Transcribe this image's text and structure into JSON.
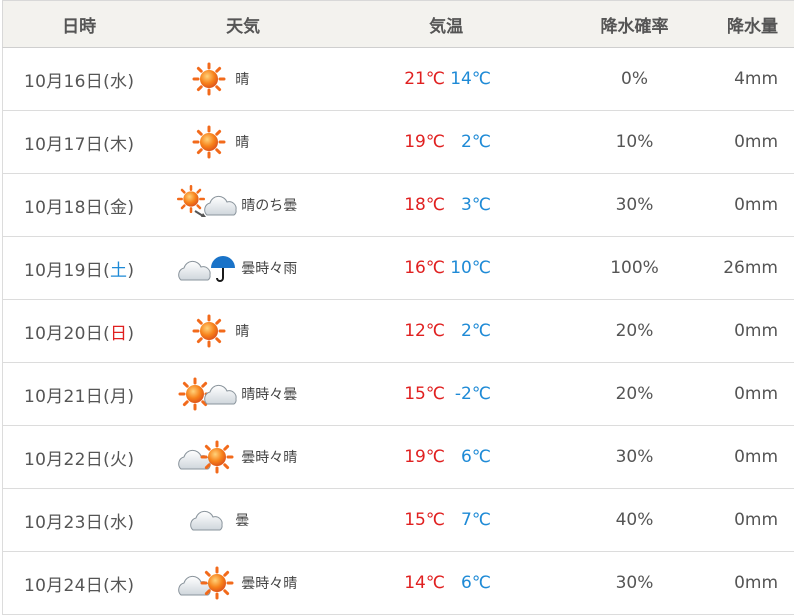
{
  "header": {
    "date": "日時",
    "weather": "天気",
    "temp": "気温",
    "prob": "降水確率",
    "amount": "降水量"
  },
  "colors": {
    "high": "#e02020",
    "low": "#1e8ad6",
    "saturday": "#1e8ad6",
    "sunday": "#e02020"
  },
  "rows": [
    {
      "date_pre": "10月16日(",
      "dow": "水",
      "date_post": ")",
      "dow_type": "",
      "icon": "sun-icon",
      "weather": "晴",
      "high": "21℃",
      "low": "14℃",
      "prob": "0%",
      "amount": "4mm"
    },
    {
      "date_pre": "10月17日(",
      "dow": "木",
      "date_post": ")",
      "dow_type": "",
      "icon": "sun-icon",
      "weather": "晴",
      "high": "19℃",
      "low": "2℃",
      "prob": "10%",
      "amount": "0mm"
    },
    {
      "date_pre": "10月18日(",
      "dow": "金",
      "date_post": ")",
      "dow_type": "",
      "icon": "sun-then-cloud-icon",
      "weather": "晴のち曇",
      "high": "18℃",
      "low": "3℃",
      "prob": "30%",
      "amount": "0mm"
    },
    {
      "date_pre": "10月19日(",
      "dow": "土",
      "date_post": ")",
      "dow_type": "sat",
      "icon": "cloud-sometimes-rain-icon",
      "weather": "曇時々雨",
      "high": "16℃",
      "low": "10℃",
      "prob": "100%",
      "amount": "26mm"
    },
    {
      "date_pre": "10月20日(",
      "dow": "日",
      "date_post": ")",
      "dow_type": "sun",
      "icon": "sun-icon",
      "weather": "晴",
      "high": "12℃",
      "low": "2℃",
      "prob": "20%",
      "amount": "0mm"
    },
    {
      "date_pre": "10月21日(",
      "dow": "月",
      "date_post": ")",
      "dow_type": "",
      "icon": "sun-sometimes-cloud-icon",
      "weather": "晴時々曇",
      "high": "15℃",
      "low": "-2℃",
      "prob": "20%",
      "amount": "0mm"
    },
    {
      "date_pre": "10月22日(",
      "dow": "火",
      "date_post": ")",
      "dow_type": "",
      "icon": "cloud-sometimes-sun-icon",
      "weather": "曇時々晴",
      "high": "19℃",
      "low": "6℃",
      "prob": "30%",
      "amount": "0mm"
    },
    {
      "date_pre": "10月23日(",
      "dow": "水",
      "date_post": ")",
      "dow_type": "",
      "icon": "cloud-icon",
      "weather": "曇",
      "high": "15℃",
      "low": "7℃",
      "prob": "40%",
      "amount": "0mm"
    },
    {
      "date_pre": "10月24日(",
      "dow": "木",
      "date_post": ")",
      "dow_type": "",
      "icon": "cloud-sometimes-sun-icon",
      "weather": "曇時々晴",
      "high": "14℃",
      "low": "6℃",
      "prob": "30%",
      "amount": "0mm"
    }
  ]
}
